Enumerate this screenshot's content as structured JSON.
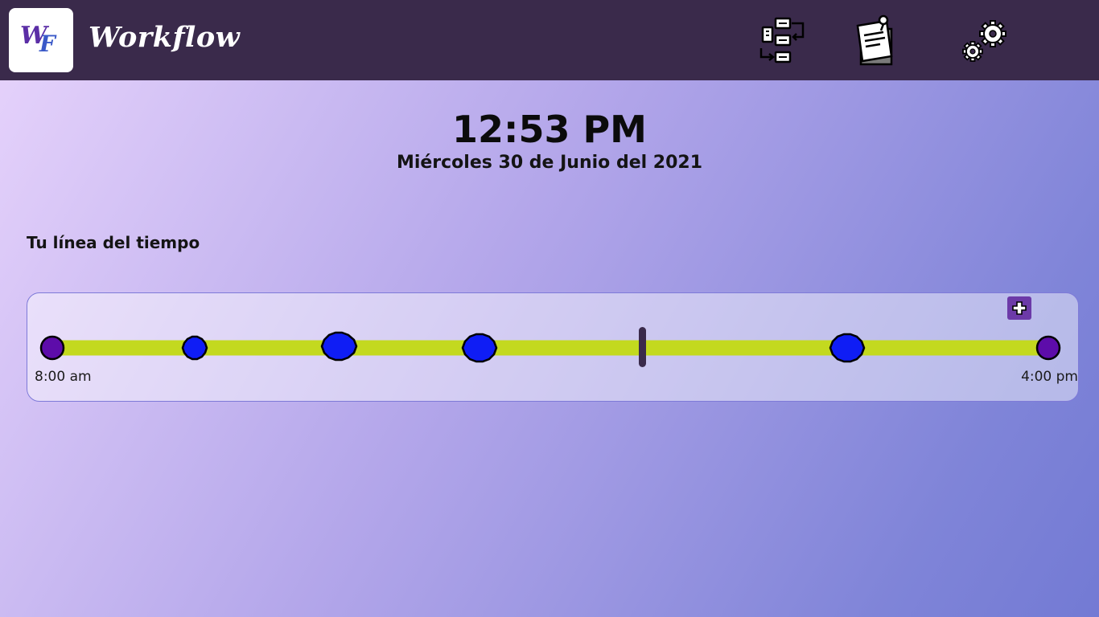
{
  "app": {
    "logo_text": "WF",
    "title": "Workflow"
  },
  "nav": [
    {
      "name": "flowchart-icon"
    },
    {
      "name": "notes-icon"
    },
    {
      "name": "settings-icon"
    }
  ],
  "clock": {
    "time": "12:53 PM",
    "date": "Miércoles 30 de Junio del 2021"
  },
  "timeline": {
    "title": "Tu línea del tiempo",
    "start_label": "8:00 am",
    "end_label": "4:00 pm",
    "add_icon": "plus-icon",
    "colors": {
      "track": "#c3d91f",
      "endpoint": "#5d0caa",
      "event": "#0f1df5",
      "now_marker": "#3a2a4b",
      "add_button": "#6c3aa8"
    }
  }
}
